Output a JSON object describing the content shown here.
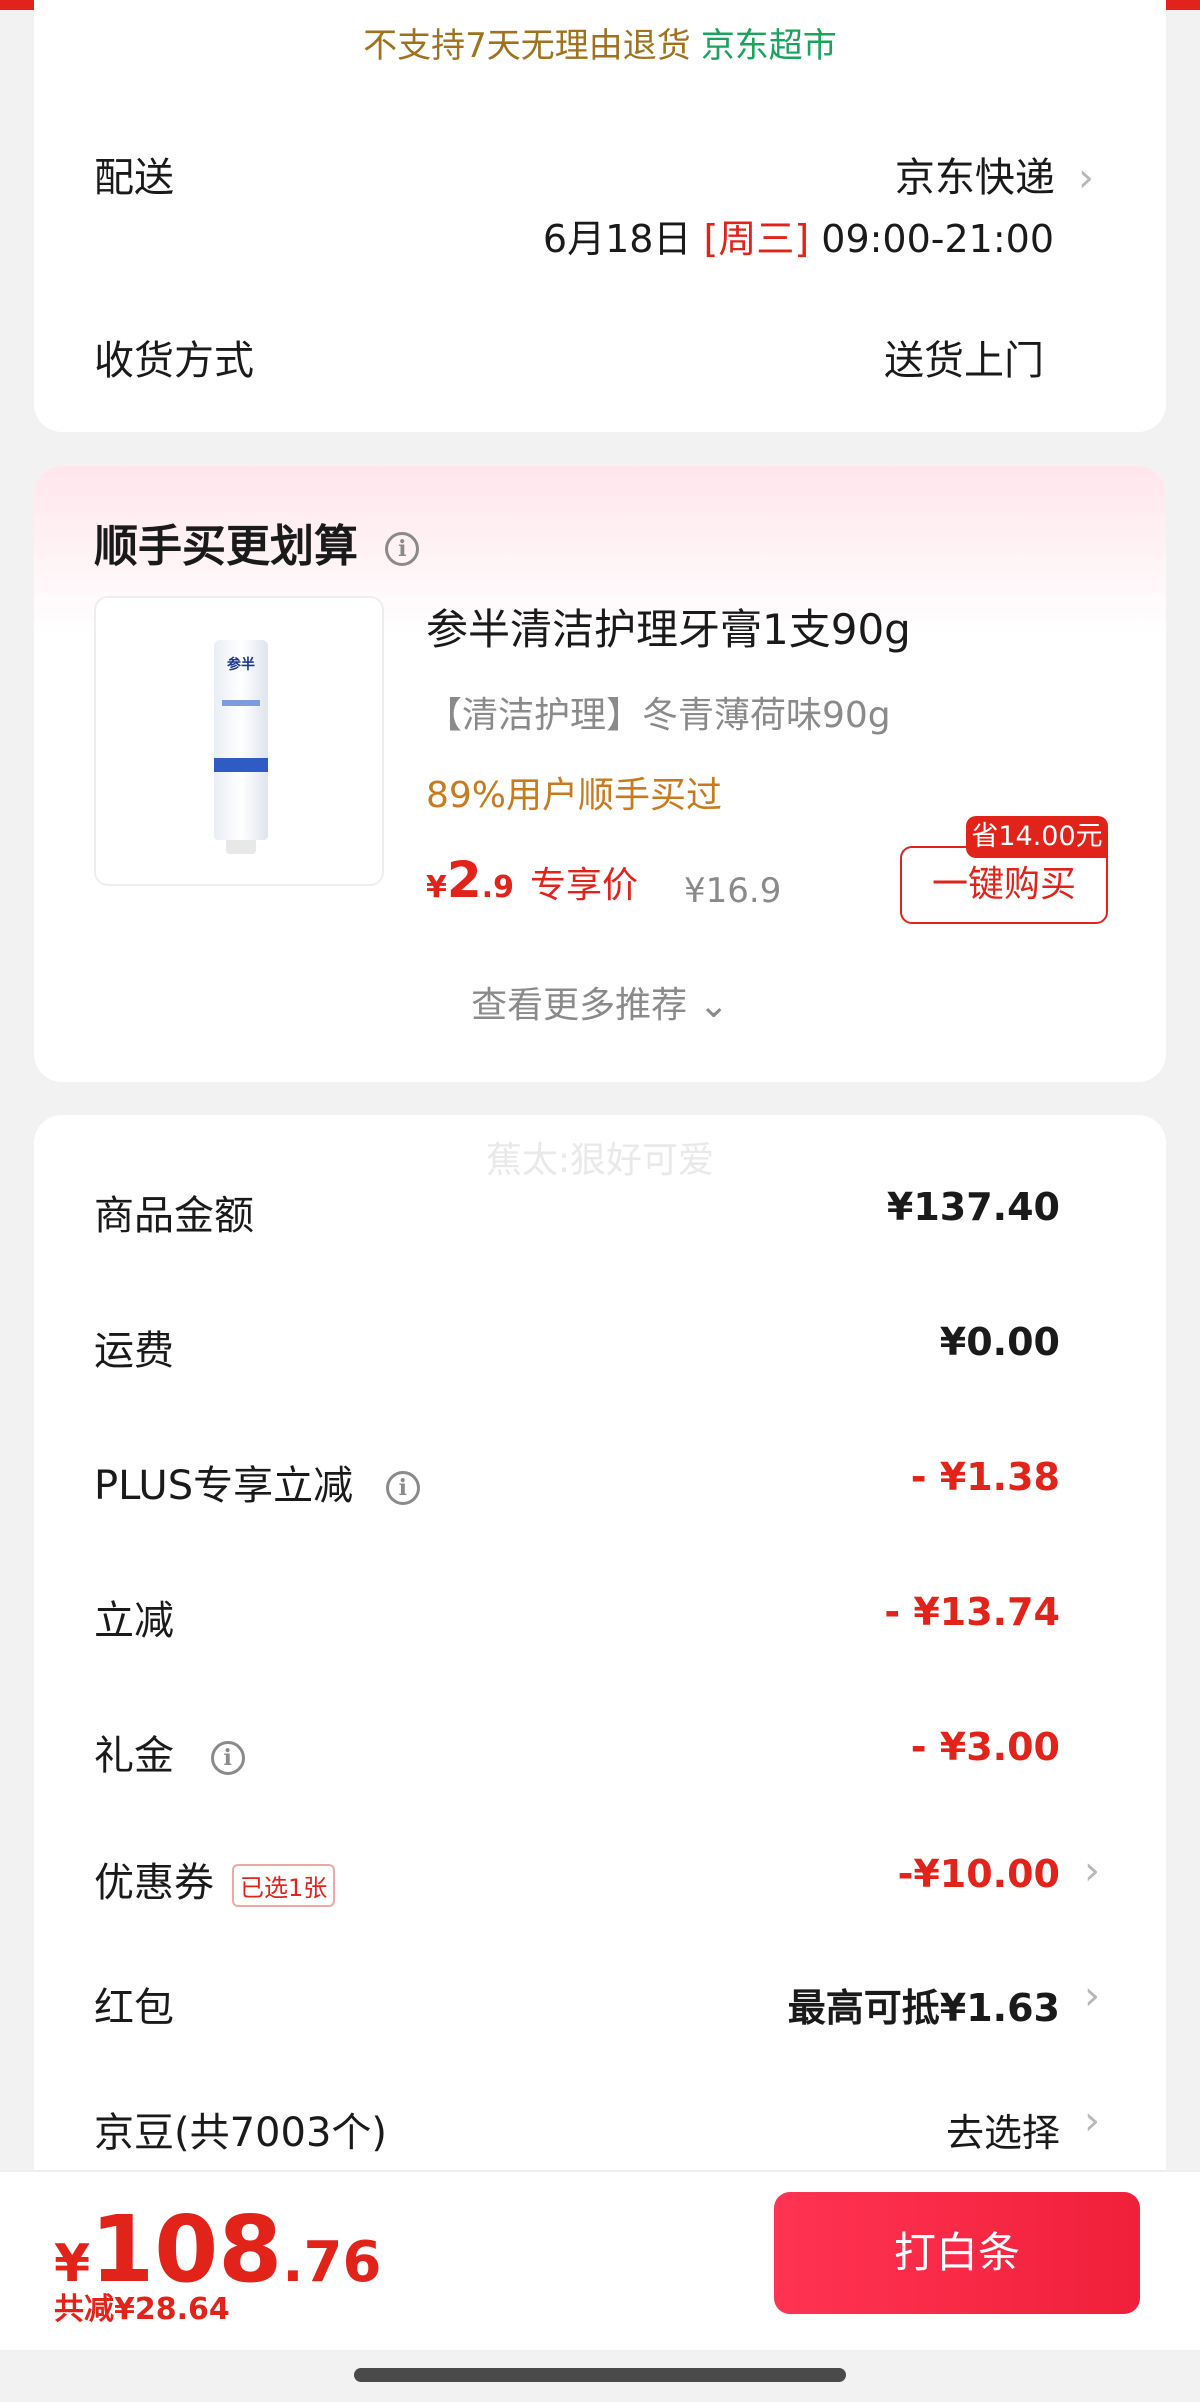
{
  "top_card": {
    "notice_warn": "不支持7天无理由退货",
    "notice_market": "京东超市",
    "delivery_label": "配送",
    "delivery_value": "京东快递",
    "delivery_date": "6月18日",
    "delivery_weekday": "[周三]",
    "delivery_hours": "09:00-21:00",
    "receive_label": "收货方式",
    "receive_value": "送货上门"
  },
  "recommend": {
    "title": "顺手买更划算",
    "product_image_brand": "参半",
    "product_name": "参半清洁护理牙膏1支90g",
    "product_spec": "【清洁护理】冬青薄荷味90g",
    "buyers": "89%用户顺手买过",
    "price_yen": "¥",
    "price_int": "2",
    "price_dec": ".9",
    "price_tag": "专享价",
    "original_price": "¥16.9",
    "save_badge": "省14.00元",
    "buy_button": "一键购买",
    "more": "查看更多推荐",
    "more_chevron": "⌄"
  },
  "summary": {
    "watermark": "蕉太:狠好可爱",
    "rows": [
      {
        "label": "商品金额",
        "value": "¥137.40"
      },
      {
        "label": "运费",
        "value": "¥0.00"
      },
      {
        "label": "PLUS专享立减",
        "value": "- ¥1.38"
      },
      {
        "label": "立减",
        "value": "- ¥13.74"
      },
      {
        "label": "礼金",
        "value": "- ¥3.00"
      },
      {
        "label": "优惠券",
        "tag": "已选1张",
        "value": "-¥10.00"
      },
      {
        "label": "红包",
        "value": "最高可抵¥1.63"
      },
      {
        "label": "京豆(共7003个)",
        "value": "去选择"
      }
    ]
  },
  "bottom": {
    "total_yen": "¥",
    "total_int": "108",
    "total_dec": ".76",
    "saved": "共减¥28.64",
    "pay_button": "打白条"
  },
  "icons": {
    "chevron": "›",
    "info": "i"
  },
  "colors": {
    "accent_red": "#e2231a",
    "market_green": "#1aa35c",
    "warn_brown": "#a0721e",
    "buyers_orange": "#c87b1e"
  }
}
